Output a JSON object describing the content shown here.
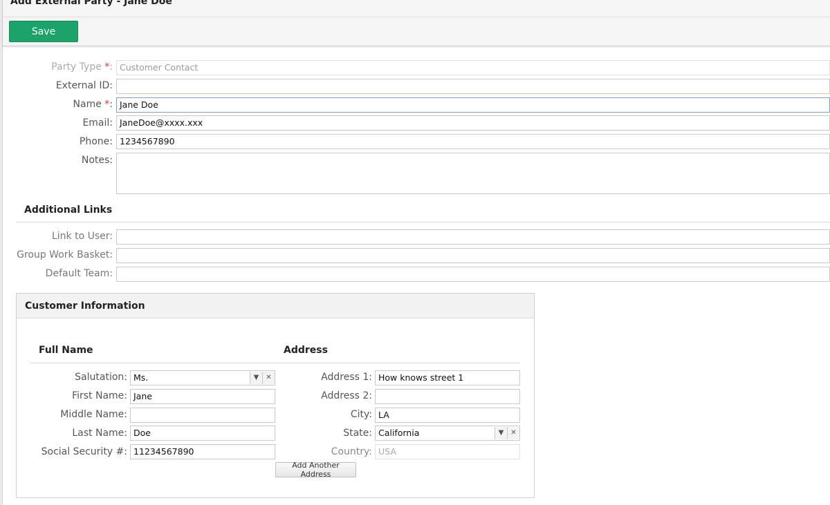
{
  "header": {
    "title": "Add External Party - Jane Doe",
    "save_label": "Save"
  },
  "party": {
    "party_type_label": "Party Type ",
    "party_type_value": "Customer Contact",
    "external_id_label": "External ID:",
    "external_id_value": "",
    "name_label": "Name ",
    "name_value": "Jane Doe",
    "email_label": "Email:",
    "email_value": "JaneDoe@xxxx.xxx",
    "phone_label": "Phone:",
    "phone_value": "1234567890",
    "notes_label": "Notes:",
    "notes_value": "",
    "required_mark": "*",
    "required_suffix": ":"
  },
  "links": {
    "heading": "Additional Links",
    "user_label": "Link to User:",
    "user_value": "",
    "basket_label": "Group Work Basket:",
    "basket_value": "",
    "team_label": "Default Team:",
    "team_value": ""
  },
  "customer": {
    "heading": "Customer Information",
    "full_name_heading": "Full Name",
    "address_heading": "Address",
    "salutation_label": "Salutation:",
    "salutation_value": "Ms.",
    "first_label": "First Name:",
    "first_value": "Jane",
    "middle_label": "Middle Name:",
    "middle_value": "",
    "last_label": "Last Name:",
    "last_value": "Doe",
    "ssn_label": "Social Security #:",
    "ssn_value": "11234567890",
    "addr1_label": "Address 1:",
    "addr1_value": "How knows street 1",
    "addr2_label": "Address 2:",
    "addr2_value": "",
    "city_label": "City:",
    "city_value": "LA",
    "state_label": "State:",
    "state_value": "California",
    "country_label": "Country:",
    "country_value": "USA",
    "add_address_label": "Add Another Address"
  },
  "icons": {
    "dropdown": "chevron-down-icon",
    "clear": "clear-x-icon"
  },
  "colors": {
    "save_button": "#1ba36a",
    "required": "#e0312e"
  }
}
